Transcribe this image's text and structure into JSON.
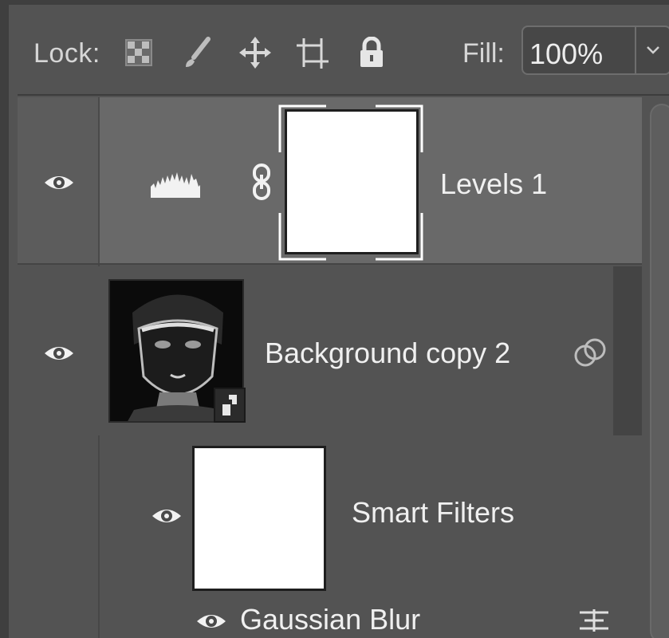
{
  "lock_bar": {
    "lock_label": "Lock:",
    "fill_label": "Fill:",
    "fill_value": "100%"
  },
  "layers": [
    {
      "name": "Levels 1",
      "type": "adjustment-levels",
      "visible": true,
      "selected": true
    },
    {
      "name": "Background copy 2",
      "type": "smart-object",
      "visible": true,
      "selected": false
    }
  ],
  "smart_filters": {
    "label": "Smart Filters",
    "filters": [
      {
        "name": "Gaussian Blur"
      }
    ]
  },
  "colors": {
    "panel_bg": "#535353",
    "selected_row": "#696969",
    "text": "#f0f0f0"
  }
}
